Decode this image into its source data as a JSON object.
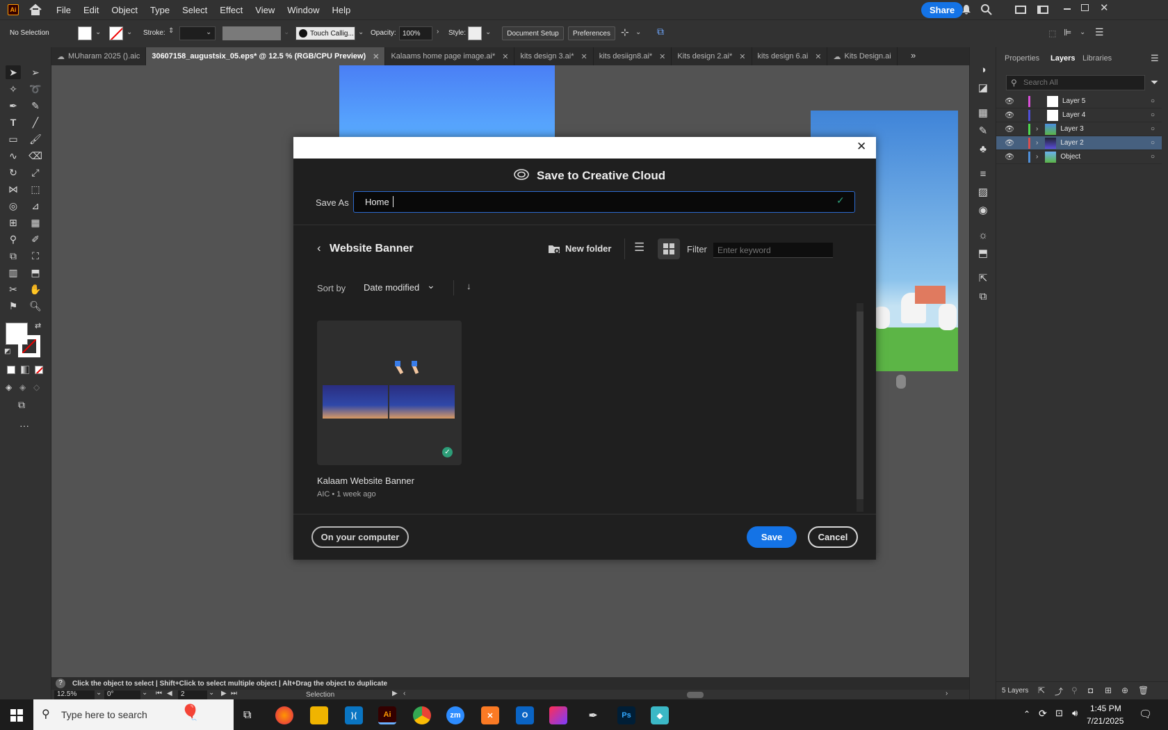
{
  "menubar": {
    "logo": "Ai",
    "items": [
      "File",
      "Edit",
      "Object",
      "Type",
      "Select",
      "Effect",
      "View",
      "Window",
      "Help"
    ],
    "share": "Share"
  },
  "controlbar": {
    "selection": "No Selection",
    "stroke_label": "Stroke:",
    "brush": "Touch Callig...",
    "opacity_label": "Opacity:",
    "opacity_value": "100%",
    "style_label": "Style:",
    "document_setup": "Document Setup",
    "preferences": "Preferences"
  },
  "tabs": [
    {
      "label": "MUharam 2025 ().aic",
      "active": false,
      "close": ""
    },
    {
      "label": "30607158_augustsix_05.eps* @ 12.5 % (RGB/CPU Preview)",
      "active": true,
      "close": "✕"
    },
    {
      "label": "Kalaams home page image.ai*",
      "active": false,
      "close": "✕"
    },
    {
      "label": "kits design 3.ai*",
      "active": false,
      "close": "✕"
    },
    {
      "label": "kits desiign8.ai*",
      "active": false,
      "close": "✕"
    },
    {
      "label": "Kits design 2.ai*",
      "active": false,
      "close": "✕"
    },
    {
      "label": "kits design 6.ai",
      "active": false,
      "close": "✕"
    },
    {
      "label": "Kits Design.ai",
      "active": false,
      "close": ""
    }
  ],
  "panel": {
    "tabs": [
      "Properties",
      "Layers",
      "Libraries"
    ],
    "search_placeholder": "Search All",
    "layers": [
      {
        "name": "Layer 5",
        "color": "#d84fd8",
        "expandable": false,
        "selected": false
      },
      {
        "name": "Layer 4",
        "color": "#4f4fd8",
        "expandable": false,
        "selected": false
      },
      {
        "name": "Layer 3",
        "color": "#4fd84f",
        "expandable": true,
        "selected": false
      },
      {
        "name": "Layer 2",
        "color": "#d84f4f",
        "expandable": true,
        "selected": true
      },
      {
        "name": "Object",
        "color": "#4f8fd8",
        "expandable": true,
        "selected": false
      }
    ],
    "footer": "5 Layers"
  },
  "status": {
    "hint": "Click the object to select  |  Shift+Click to select multiple object  |  Alt+Drag the object to duplicate",
    "zoom": "12.5%",
    "rotation": "0°",
    "artboard": "2",
    "mode": "Selection"
  },
  "dialog": {
    "title": "Save to Creative Cloud",
    "save_as_label": "Save As",
    "save_as_value": "Home",
    "folder": "Website Banner",
    "new_folder": "New folder",
    "filter_label": "Filter",
    "filter_placeholder": "Enter keyword",
    "sort_label": "Sort by",
    "sort_value": "Date modified",
    "file": {
      "name": "Kalaam Website Banner",
      "meta": "AIC • 1 week ago"
    },
    "on_computer": "On your computer",
    "save": "Save",
    "cancel": "Cancel",
    "accent": "#1473e6"
  },
  "taskbar": {
    "search": "Type here to search",
    "time": "1:45 PM",
    "date": "7/21/2025"
  }
}
